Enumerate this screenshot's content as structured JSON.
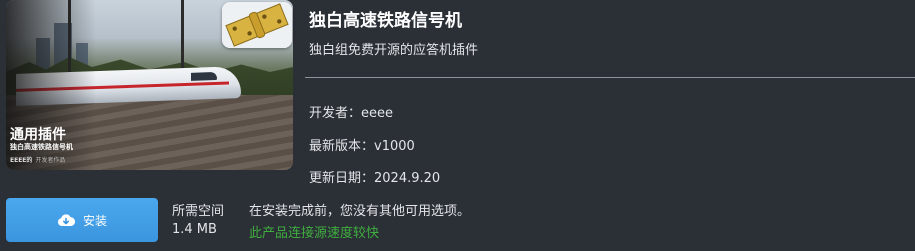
{
  "thumbnail": {
    "category": "通用插件",
    "name": "独白高速铁路信号机",
    "author": "EEEE的",
    "tag": "开发者作品"
  },
  "plugin": {
    "title": "独白高速铁路信号机",
    "subtitle": "独白组免费开源的应答机插件",
    "developer_label": "开发者：",
    "developer": "eeee",
    "version_label": "最新版本：",
    "version": "v1000",
    "updated_label": "更新日期：",
    "updated": "2024.9.20"
  },
  "install": {
    "button_label": "安装",
    "icon": "cloud-download-icon",
    "space_label": "所需空间",
    "space_value": "1.4 MB",
    "notice": "在安装完成前，您没有其他可用选项。",
    "speed_note": "此产品连接源速度较快"
  },
  "colors": {
    "accent": "#3b95de",
    "speed_note": "#3fae3f",
    "background": "#2b2f36"
  }
}
